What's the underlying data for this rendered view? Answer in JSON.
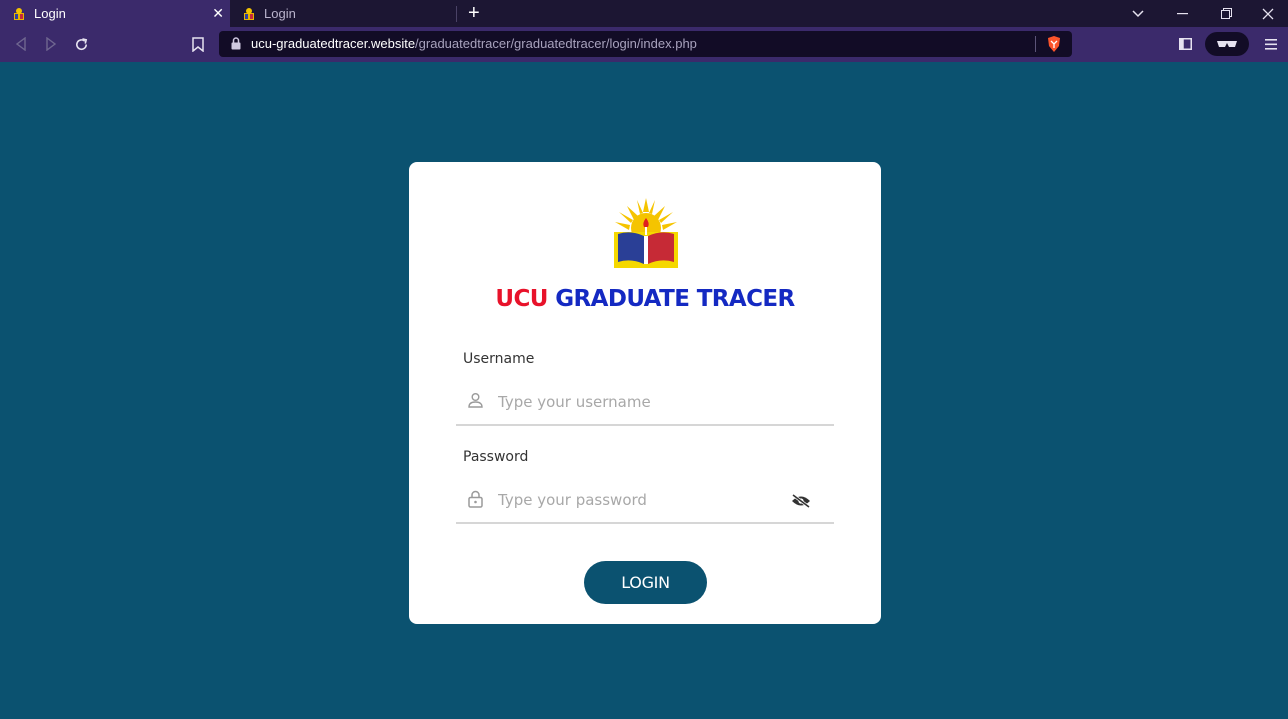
{
  "browser": {
    "tabs": [
      {
        "title": "Login",
        "active": true
      },
      {
        "title": "Login",
        "active": false
      }
    ],
    "new_tab_label": "+",
    "url_host": "ucu-graduatedtracer.website",
    "url_path": "/graduatedtracer/graduatedtracer/login/index.php"
  },
  "login": {
    "brand_part1": "UCU",
    "brand_part2": "GRADUATE TRACER",
    "username_label": "Username",
    "username_placeholder": "Type your username",
    "password_label": "Password",
    "password_placeholder": "Type your password",
    "login_button": "LOGIN"
  },
  "colors": {
    "background": "#0b5270",
    "brand_red": "#e8122a",
    "brand_blue": "#1429c2",
    "button": "#0b5270",
    "browser_toolbar": "#3b2a6b"
  }
}
